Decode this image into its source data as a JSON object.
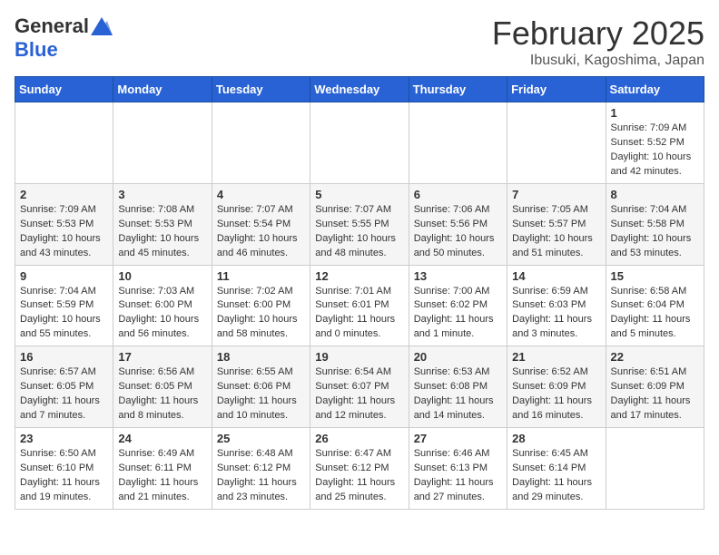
{
  "header": {
    "logo_general": "General",
    "logo_blue": "Blue",
    "month_title": "February 2025",
    "location": "Ibusuki, Kagoshima, Japan"
  },
  "weekdays": [
    "Sunday",
    "Monday",
    "Tuesday",
    "Wednesday",
    "Thursday",
    "Friday",
    "Saturday"
  ],
  "weeks": [
    [
      {
        "day": "",
        "info": ""
      },
      {
        "day": "",
        "info": ""
      },
      {
        "day": "",
        "info": ""
      },
      {
        "day": "",
        "info": ""
      },
      {
        "day": "",
        "info": ""
      },
      {
        "day": "",
        "info": ""
      },
      {
        "day": "1",
        "info": "Sunrise: 7:09 AM\nSunset: 5:52 PM\nDaylight: 10 hours\nand 42 minutes."
      }
    ],
    [
      {
        "day": "2",
        "info": "Sunrise: 7:09 AM\nSunset: 5:53 PM\nDaylight: 10 hours\nand 43 minutes."
      },
      {
        "day": "3",
        "info": "Sunrise: 7:08 AM\nSunset: 5:53 PM\nDaylight: 10 hours\nand 45 minutes."
      },
      {
        "day": "4",
        "info": "Sunrise: 7:07 AM\nSunset: 5:54 PM\nDaylight: 10 hours\nand 46 minutes."
      },
      {
        "day": "5",
        "info": "Sunrise: 7:07 AM\nSunset: 5:55 PM\nDaylight: 10 hours\nand 48 minutes."
      },
      {
        "day": "6",
        "info": "Sunrise: 7:06 AM\nSunset: 5:56 PM\nDaylight: 10 hours\nand 50 minutes."
      },
      {
        "day": "7",
        "info": "Sunrise: 7:05 AM\nSunset: 5:57 PM\nDaylight: 10 hours\nand 51 minutes."
      },
      {
        "day": "8",
        "info": "Sunrise: 7:04 AM\nSunset: 5:58 PM\nDaylight: 10 hours\nand 53 minutes."
      }
    ],
    [
      {
        "day": "9",
        "info": "Sunrise: 7:04 AM\nSunset: 5:59 PM\nDaylight: 10 hours\nand 55 minutes."
      },
      {
        "day": "10",
        "info": "Sunrise: 7:03 AM\nSunset: 6:00 PM\nDaylight: 10 hours\nand 56 minutes."
      },
      {
        "day": "11",
        "info": "Sunrise: 7:02 AM\nSunset: 6:00 PM\nDaylight: 10 hours\nand 58 minutes."
      },
      {
        "day": "12",
        "info": "Sunrise: 7:01 AM\nSunset: 6:01 PM\nDaylight: 11 hours\nand 0 minutes."
      },
      {
        "day": "13",
        "info": "Sunrise: 7:00 AM\nSunset: 6:02 PM\nDaylight: 11 hours\nand 1 minute."
      },
      {
        "day": "14",
        "info": "Sunrise: 6:59 AM\nSunset: 6:03 PM\nDaylight: 11 hours\nand 3 minutes."
      },
      {
        "day": "15",
        "info": "Sunrise: 6:58 AM\nSunset: 6:04 PM\nDaylight: 11 hours\nand 5 minutes."
      }
    ],
    [
      {
        "day": "16",
        "info": "Sunrise: 6:57 AM\nSunset: 6:05 PM\nDaylight: 11 hours\nand 7 minutes."
      },
      {
        "day": "17",
        "info": "Sunrise: 6:56 AM\nSunset: 6:05 PM\nDaylight: 11 hours\nand 8 minutes."
      },
      {
        "day": "18",
        "info": "Sunrise: 6:55 AM\nSunset: 6:06 PM\nDaylight: 11 hours\nand 10 minutes."
      },
      {
        "day": "19",
        "info": "Sunrise: 6:54 AM\nSunset: 6:07 PM\nDaylight: 11 hours\nand 12 minutes."
      },
      {
        "day": "20",
        "info": "Sunrise: 6:53 AM\nSunset: 6:08 PM\nDaylight: 11 hours\nand 14 minutes."
      },
      {
        "day": "21",
        "info": "Sunrise: 6:52 AM\nSunset: 6:09 PM\nDaylight: 11 hours\nand 16 minutes."
      },
      {
        "day": "22",
        "info": "Sunrise: 6:51 AM\nSunset: 6:09 PM\nDaylight: 11 hours\nand 17 minutes."
      }
    ],
    [
      {
        "day": "23",
        "info": "Sunrise: 6:50 AM\nSunset: 6:10 PM\nDaylight: 11 hours\nand 19 minutes."
      },
      {
        "day": "24",
        "info": "Sunrise: 6:49 AM\nSunset: 6:11 PM\nDaylight: 11 hours\nand 21 minutes."
      },
      {
        "day": "25",
        "info": "Sunrise: 6:48 AM\nSunset: 6:12 PM\nDaylight: 11 hours\nand 23 minutes."
      },
      {
        "day": "26",
        "info": "Sunrise: 6:47 AM\nSunset: 6:12 PM\nDaylight: 11 hours\nand 25 minutes."
      },
      {
        "day": "27",
        "info": "Sunrise: 6:46 AM\nSunset: 6:13 PM\nDaylight: 11 hours\nand 27 minutes."
      },
      {
        "day": "28",
        "info": "Sunrise: 6:45 AM\nSunset: 6:14 PM\nDaylight: 11 hours\nand 29 minutes."
      },
      {
        "day": "",
        "info": ""
      }
    ]
  ]
}
